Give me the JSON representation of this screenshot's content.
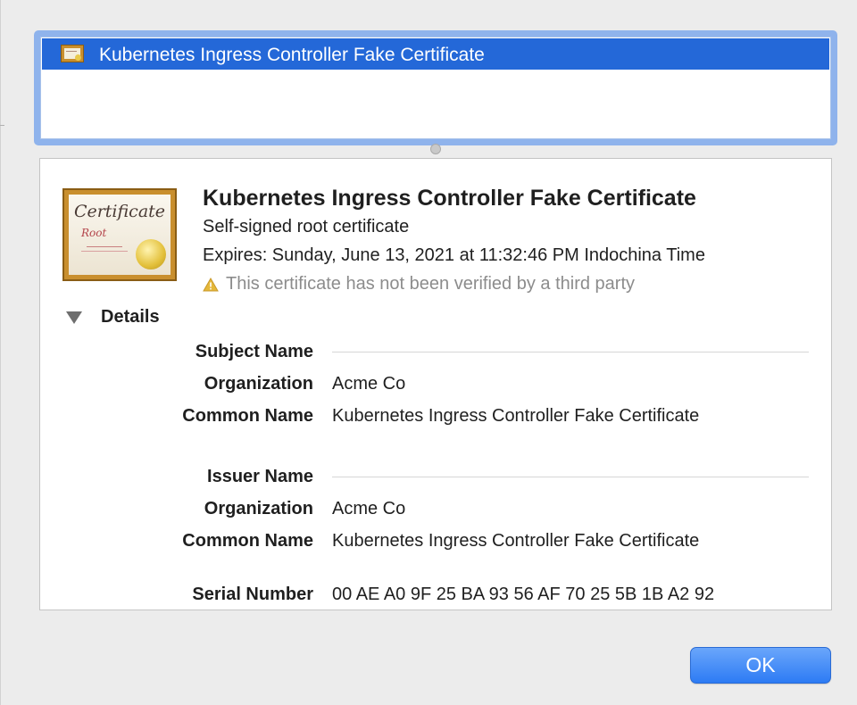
{
  "certificate_list": {
    "items": [
      {
        "label": "Kubernetes Ingress Controller Fake Certificate",
        "selected": true
      }
    ]
  },
  "detail": {
    "badge": {
      "title": "Certificate",
      "subtitle": "Root"
    },
    "title": "Kubernetes Ingress Controller Fake Certificate",
    "type": "Self-signed root certificate",
    "expiry": "Expires: Sunday, June 13, 2021 at 11:32:46 PM Indochina Time",
    "warning": "This certificate has not been verified by a third party",
    "details_label": "Details",
    "details_expanded": true,
    "subject": {
      "heading": "Subject Name",
      "organization_label": "Organization",
      "organization": "Acme Co",
      "common_name_label": "Common Name",
      "common_name": "Kubernetes Ingress Controller Fake Certificate"
    },
    "issuer": {
      "heading": "Issuer Name",
      "organization_label": "Organization",
      "organization": "Acme Co",
      "common_name_label": "Common Name",
      "common_name": "Kubernetes Ingress Controller Fake Certificate"
    },
    "serial": {
      "label": "Serial Number",
      "value": "00 AE A0 9F 25 BA 93 56 AF 70 25 5B 1B A2 92"
    }
  },
  "buttons": {
    "ok": "OK"
  },
  "colors": {
    "selection": "#2468d8",
    "button_accent": "#2d7bf4",
    "warning": "#e5b83a"
  }
}
